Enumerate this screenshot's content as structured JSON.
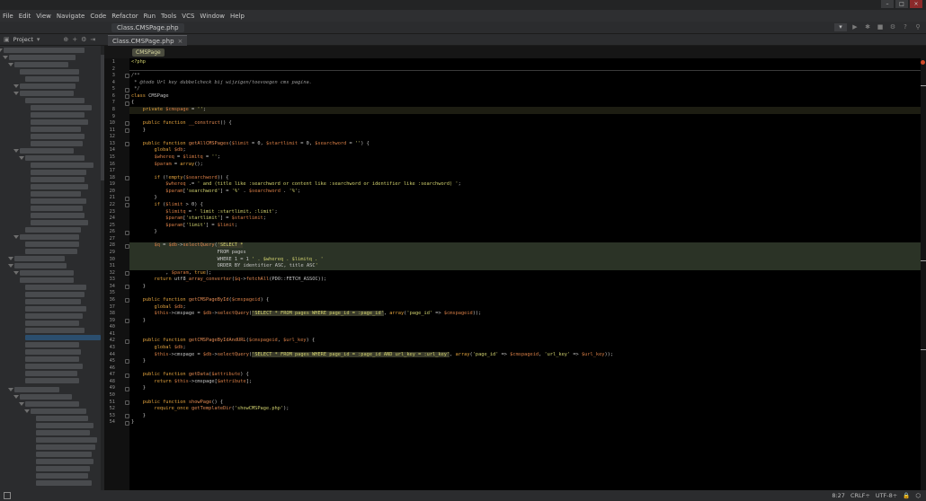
{
  "menu": [
    "File",
    "Edit",
    "View",
    "Navigate",
    "Code",
    "Refactor",
    "Run",
    "Tools",
    "VCS",
    "Window",
    "Help"
  ],
  "nav_file": "Class.CMSPage.php",
  "project": {
    "label": "Project"
  },
  "editor": {
    "tab_label": "Class.CMSPage.php",
    "breadcrumb": "CMSPage"
  },
  "status": {
    "position": "8:27",
    "line_sep": "CRLF÷",
    "encoding": "UTF-8÷"
  },
  "code_lines": [
    "<?php",
    "",
    "/**",
    " * @todo Url key dubbelcheck bij wijzigen/toevoegen cms pagina.",
    " */",
    "class CMSPage",
    "{",
    "    private $cmspage = '';",
    "",
    "    public function __construct() {",
    "    }",
    "",
    "    public function getAllCMSPages($limit = 0, $startlimit = 0, $searchword = '') {",
    "        global $db;",
    "        $whereq = $limitq = '';",
    "        $param = array();",
    "",
    "        if (!empty($searchword)) {",
    "            $whereq .= ' and (title like :searchword or content like :searchword or identifier like :searchword) ';",
    "            $param['searchword'] = '%' . $searchword . '%';",
    "        }",
    "        if ($limit > 0) {",
    "            $limitq = ' limit :startlimit, :limit';",
    "            $param['startlimit'] = $startlimit;",
    "            $param['limit'] = $limit;",
    "        }",
    "",
    "        $q = $db->selectQuery('SELECT *",
    "                              FROM pages",
    "                              WHERE 1 = 1 ' . $whereq . $limitq . '",
    "                              ORDER BY identifier ASC, title ASC'",
    "            , $param, true);",
    "        return utf8_array_converter($q->fetchAll(PDO::FETCH_ASSOC));",
    "    }",
    "",
    "    public function getCMSPageById($cmspageid) {",
    "        global $db;",
    "        $this->cmspage = $db->selectQuery('SELECT * FROM pages WHERE page_id = :page_id', array('page_id' => $cmspageid));",
    "    }",
    "",
    "",
    "    public function getCMSPageByIdAndURL($cmspageid, $url_key) {",
    "        global $db;",
    "        $this->cmspage = $db->selectQuery('SELECT * FROM pages WHERE page_id = :page_id AND url_key = :url_key', array('page_id' => $cmspageid, 'url_key' => $url_key));",
    "    }",
    "",
    "    public function getData($attribute) {",
    "        return $this->cmspage[$attribute];",
    "    }",
    "",
    "    public function showPage() {",
    "        require_once getTemplateDir('showCMSPage.php');",
    "    }",
    "}"
  ]
}
